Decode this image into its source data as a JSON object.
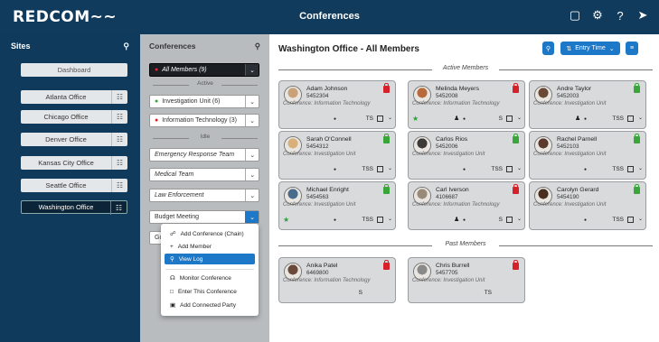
{
  "topbar": {
    "logo": "REDCOM",
    "logo_suffix": "~~",
    "title": "Conferences",
    "icons": [
      "contact-card-icon",
      "gear-icon",
      "help-icon",
      "logout-icon"
    ]
  },
  "sites": {
    "title": "Sites",
    "dashboard": "Dashboard",
    "items": [
      "Atlanta Office",
      "Chicago Office",
      "Denver Office",
      "Kansas City Office",
      "Seattle Office",
      "Washington Office"
    ]
  },
  "conferences": {
    "title": "Conferences",
    "all_members": "All Members (9)",
    "active_sep": "Active",
    "idle_sep": "Idle",
    "active_items": [
      "Investigation Unit (6)",
      "Information Technology (3)"
    ],
    "idle_items": [
      "Emergency Response Team",
      "Medical Team",
      "Law Enforcement",
      "Budget Meeting"
    ],
    "partial_item": "Go"
  },
  "context_menu": {
    "items": [
      "Add Conference (Chain)",
      "Add Member",
      "View Log",
      "Monitor Conference",
      "Enter This Conference",
      "Add Connected Party"
    ],
    "selected": "View Log"
  },
  "main": {
    "title": "Washington Office - All Members",
    "sort_label": "Entry Time",
    "active_label": "Active Members",
    "past_label": "Past Members",
    "active_members": [
      {
        "name": "Adam Johnson",
        "num": "5452304",
        "conf": "Conference: Information Technology",
        "lock": "red",
        "star": false,
        "ppl": false,
        "label": "TS",
        "color": "#c9a27a"
      },
      {
        "name": "Melinda Meyers",
        "num": "5452008",
        "conf": "Conference: Information Technology",
        "lock": "red",
        "star": true,
        "ppl": true,
        "label": "S",
        "color": "#b86a3a"
      },
      {
        "name": "Andre Taylor",
        "num": "5452003",
        "conf": "Conference: Investigation Unit",
        "lock": "green",
        "star": false,
        "ppl": true,
        "label": "TSS",
        "color": "#6b4a35"
      },
      {
        "name": "Sarah O'Connell",
        "num": "5454312",
        "conf": "Conference: Investigation Unit",
        "lock": "green",
        "star": false,
        "ppl": false,
        "label": "TSS",
        "color": "#d9b07a"
      },
      {
        "name": "Carlos Rios",
        "num": "5452006",
        "conf": "Conference: Investigation Unit",
        "lock": "green",
        "star": false,
        "ppl": false,
        "label": "TSS",
        "color": "#3d3a38"
      },
      {
        "name": "Rachel Parnell",
        "num": "5452103",
        "conf": "Conference: Investigation Unit",
        "lock": "green",
        "star": false,
        "ppl": false,
        "label": "TSS",
        "color": "#5a3a2a"
      },
      {
        "name": "Michael Enright",
        "num": "5454563",
        "conf": "Conference: Investigation Unit",
        "lock": "green",
        "star": true,
        "ppl": false,
        "label": "TSS",
        "color": "#4a6c8c"
      },
      {
        "name": "Carl Iverson",
        "num": "4106687",
        "conf": "Conference: Information Technology",
        "lock": "red",
        "star": false,
        "ppl": true,
        "label": "S",
        "color": "#9a8a7a"
      },
      {
        "name": "Carolyn Gerard",
        "num": "5454190",
        "conf": "Conference: Investigation Unit",
        "lock": "green",
        "star": false,
        "ppl": false,
        "label": "TSS",
        "color": "#4a2e20"
      }
    ],
    "past_members": [
      {
        "name": "Anika Patel",
        "num": "6469800",
        "conf": "Conference: Information Technology",
        "lock": "red",
        "label": "S",
        "color": "#6a4a3a"
      },
      {
        "name": "Chris Burrell",
        "num": "5457705",
        "conf": "Conference: Investigation Unit",
        "lock": "red",
        "label": "TS",
        "color": "#8a8a8a"
      }
    ]
  }
}
